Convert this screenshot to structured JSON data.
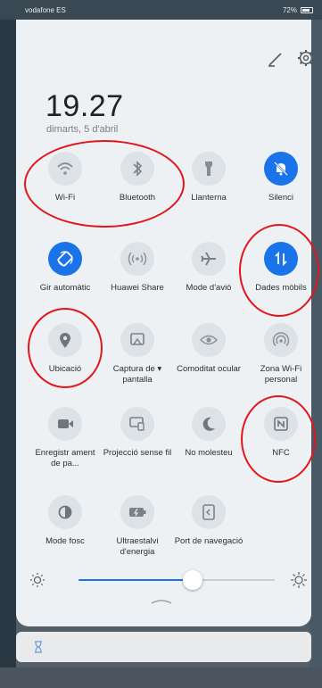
{
  "status_bar": {
    "carrier": "vodafone ES",
    "battery": "72%"
  },
  "header": {
    "time": "19.27",
    "date": "dimarts, 5 d'abril"
  },
  "tiles": [
    {
      "label": "Wi-Fi",
      "icon": "wifi-icon",
      "on": false
    },
    {
      "label": "Bluetooth",
      "icon": "bluetooth-icon",
      "on": false
    },
    {
      "label": "Llanterna",
      "icon": "flashlight-icon",
      "on": false
    },
    {
      "label": "Silenci",
      "icon": "bell-off-icon",
      "on": true
    },
    {
      "label": "Gir automàtic",
      "icon": "auto-rotate-icon",
      "on": true
    },
    {
      "label": "Huawei Share",
      "icon": "huawei-share-icon",
      "on": false
    },
    {
      "label": "Mode d'avió",
      "icon": "airplane-icon",
      "on": false
    },
    {
      "label": "Dades mòbils",
      "icon": "mobile-data-icon",
      "on": true
    },
    {
      "label": "Ubicació",
      "icon": "location-icon",
      "on": false
    },
    {
      "label": "Captura de ▾ pantalla",
      "icon": "screenshot-icon",
      "on": false
    },
    {
      "label": "Comoditat ocular",
      "icon": "eye-icon",
      "on": false
    },
    {
      "label": "Zona Wi-Fi personal",
      "icon": "hotspot-icon",
      "on": false
    },
    {
      "label": "Enregistr ament de pa...",
      "icon": "screen-record-icon",
      "on": false
    },
    {
      "label": "Projecció sense fil",
      "icon": "wireless-projection-icon",
      "on": false
    },
    {
      "label": "No molesteu",
      "icon": "moon-icon",
      "on": false
    },
    {
      "label": "NFC",
      "icon": "nfc-icon",
      "on": false
    },
    {
      "label": "Mode fosc",
      "icon": "dark-mode-icon",
      "on": false
    },
    {
      "label": "Ultraestalvi d'energia",
      "icon": "battery-saver-icon",
      "on": false
    },
    {
      "label": "Port de navegació",
      "icon": "navigation-dock-icon",
      "on": false
    }
  ],
  "brightness": {
    "level": 0.58
  },
  "colors": {
    "accent": "#1a73e8",
    "annotation": "#e3151c"
  }
}
